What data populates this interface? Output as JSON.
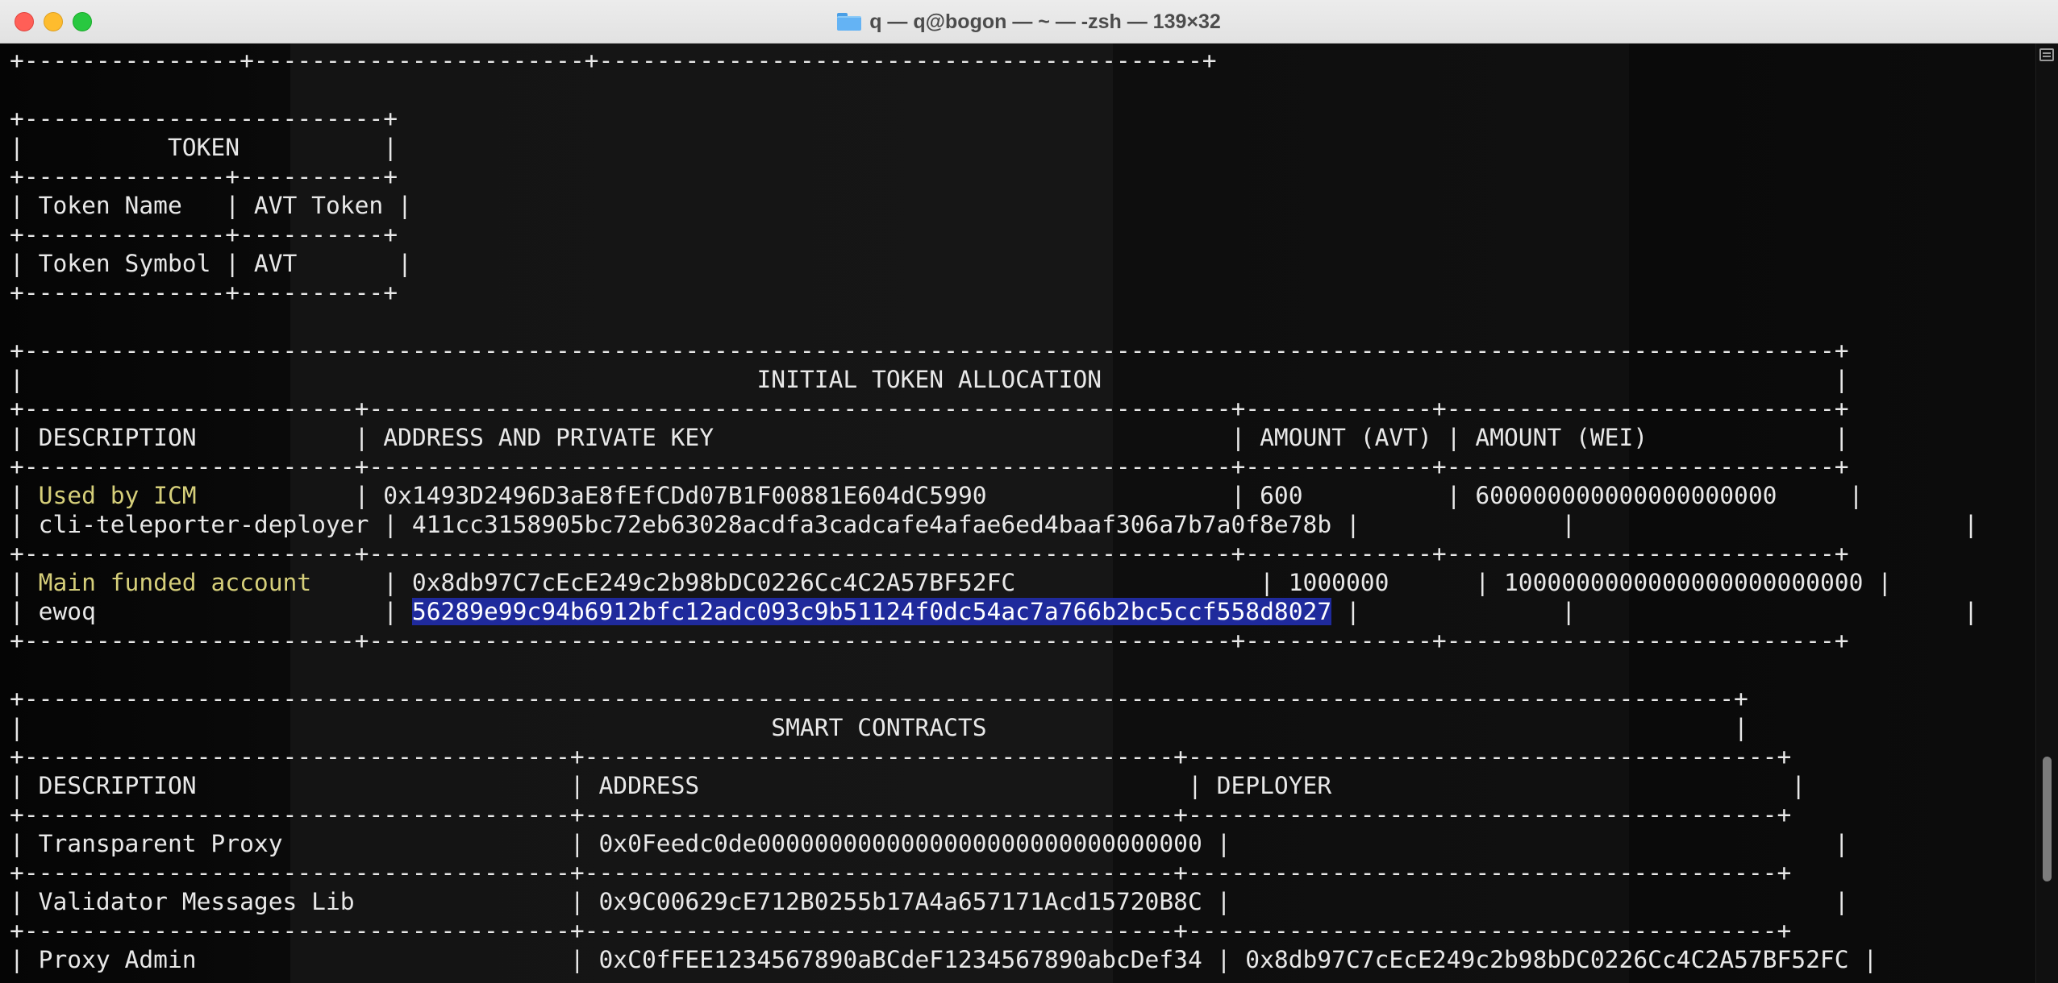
{
  "window": {
    "title": "q — q@bogon — ~ — -zsh — 139×32"
  },
  "terminal": {
    "lines": [
      [
        {
          "t": "+---------------+-----------------------+------------------------------------------+"
        }
      ],
      [
        {
          "t": ""
        }
      ],
      [
        {
          "t": "+-------------------------+"
        }
      ],
      [
        {
          "t": "|          TOKEN          |"
        }
      ],
      [
        {
          "t": "+--------------+----------+"
        }
      ],
      [
        {
          "t": "| Token Name   | AVT Token |"
        }
      ],
      [
        {
          "t": "+--------------+----------+"
        }
      ],
      [
        {
          "t": "| Token Symbol | AVT       |"
        }
      ],
      [
        {
          "t": "+--------------+----------+"
        }
      ],
      [
        {
          "t": ""
        }
      ],
      [
        {
          "t": "+------------------------------------------------------------------------------------------------------------------------------+"
        }
      ],
      [
        {
          "t": "|                                                   INITIAL TOKEN ALLOCATION                                                   |"
        }
      ],
      [
        {
          "t": "+-----------------------+------------------------------------------------------------+-------------+---------------------------+"
        }
      ],
      [
        {
          "t": "| DESCRIPTION           | ADDRESS AND PRIVATE KEY                                    | AMOUNT (AVT) | AMOUNT (WEI)             |"
        }
      ],
      [
        {
          "t": "+-----------------------+------------------------------------------------------------+-------------+---------------------------+"
        }
      ],
      [
        {
          "t": "| "
        },
        {
          "t": "Used by ICM",
          "c": "yellow"
        },
        {
          "t": "           | 0x1493D2496D3aE8fEfCDd07B1F00881E604dC5990                 | 600          | 600000000000000000000     |"
        }
      ],
      [
        {
          "t": "| cli-teleporter-deployer | 411cc3158905bc72eb63028acdfa3cadcafe4afae6ed4baaf306a7b7a0f8e78b |              |                           |"
        }
      ],
      [
        {
          "t": "+-----------------------+------------------------------------------------------------+-------------+---------------------------+"
        }
      ],
      [
        {
          "t": "| "
        },
        {
          "t": "Main funded account",
          "c": "yellow"
        },
        {
          "t": "     | 0x8db97C7cEcE249c2b98bDC0226Cc4C2A57BF52FC                 | 1000000      | 1000000000000000000000000 |"
        }
      ],
      [
        {
          "t": "| ewoq                    | "
        },
        {
          "t": "56289e99c94b6912bfc12adc093c9b51124f0dc54ac7a766b2bc5ccf558d8027",
          "c": "selected"
        },
        {
          "t": " |              |                           |"
        }
      ],
      [
        {
          "t": "+-----------------------+------------------------------------------------------------+-------------+---------------------------+"
        }
      ],
      [
        {
          "t": ""
        }
      ],
      [
        {
          "t": "+-----------------------------------------------------------------------------------------------------------------------+"
        }
      ],
      [
        {
          "t": "|                                                    SMART CONTRACTS                                                    |"
        }
      ],
      [
        {
          "t": "+--------------------------------------+-----------------------------------------+-----------------------------------------+"
        }
      ],
      [
        {
          "t": "| DESCRIPTION                          | ADDRESS                                  | DEPLOYER                                |"
        }
      ],
      [
        {
          "t": "+--------------------------------------+-----------------------------------------+-----------------------------------------+"
        }
      ],
      [
        {
          "t": "| Transparent Proxy                    | 0x0Feedc0de0000000000000000000000000000000 |                                          |"
        }
      ],
      [
        {
          "t": "+--------------------------------------+-----------------------------------------+-----------------------------------------+"
        }
      ],
      [
        {
          "t": "| Validator Messages Lib               | 0x9C00629cE712B0255b17A4a657171Acd15720B8C |                                          |"
        }
      ],
      [
        {
          "t": "+--------------------------------------+-----------------------------------------+-----------------------------------------+"
        }
      ],
      [
        {
          "t": "| Proxy Admin                          | 0xC0fFEE1234567890aBCdeF1234567890abcDef34 | 0x8db97C7cEcE249c2b98bDC0226Cc4C2A57BF52FC |"
        }
      ]
    ]
  }
}
